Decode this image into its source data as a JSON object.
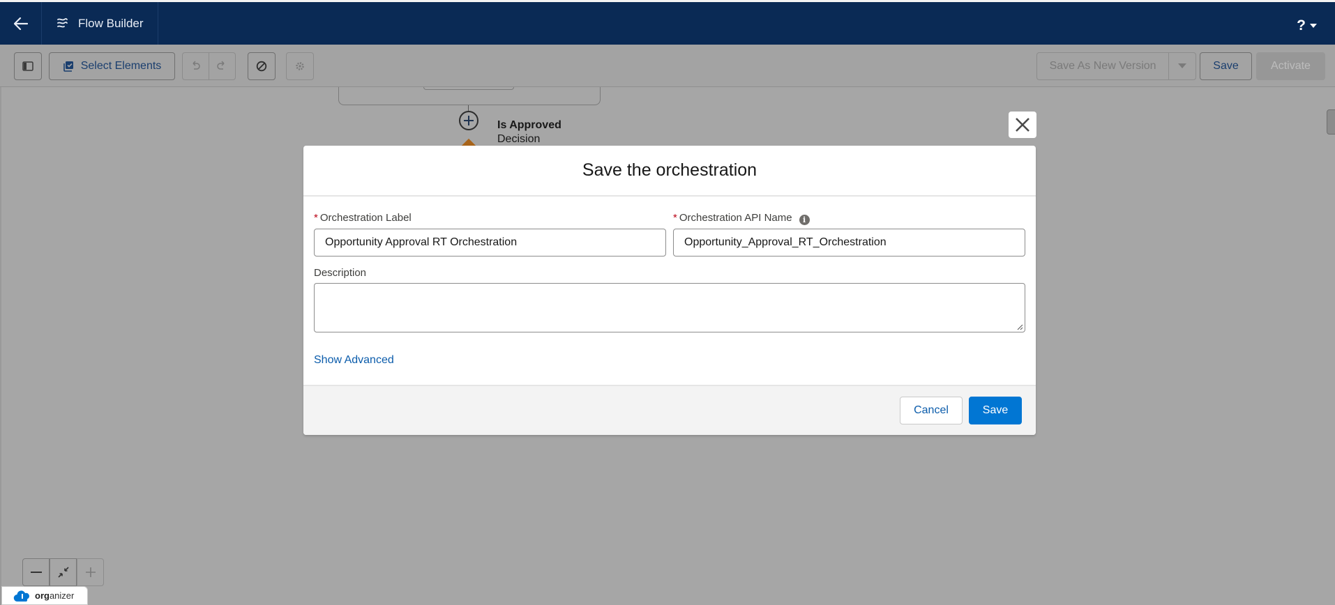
{
  "header": {
    "app_title": "Flow Builder",
    "help_label": "?"
  },
  "toolbar": {
    "select_elements_label": "Select Elements",
    "save_as_new_version_label": "Save As New Version",
    "save_label": "Save",
    "activate_label": "Activate"
  },
  "canvas": {
    "decision_title": "Is Approved",
    "decision_type": "Decision"
  },
  "footer_brand": {
    "bold": "org",
    "rest": "anizer"
  },
  "modal": {
    "title": "Save the orchestration",
    "required_marker": "*",
    "label_field": {
      "label": "Orchestration Label",
      "value": "Opportunity Approval RT Orchestration"
    },
    "api_field": {
      "label": "Orchestration API Name",
      "value": "Opportunity_Approval_RT_Orchestration",
      "info_glyph": "i"
    },
    "description_field": {
      "label": "Description",
      "value": ""
    },
    "show_advanced_label": "Show Advanced",
    "cancel_label": "Cancel",
    "save_label": "Save"
  },
  "colors": {
    "nav_bg": "#0a2a55",
    "overlay": "#a6a6a6",
    "brand_blue": "#0176d3",
    "link_blue": "#0b5cab",
    "required_red": "#ba0517"
  }
}
